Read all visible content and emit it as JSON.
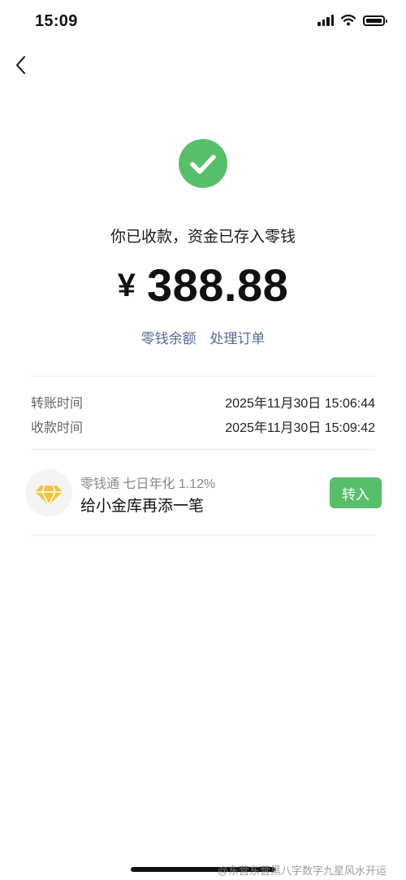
{
  "status_bar": {
    "time": "15:09"
  },
  "result": {
    "message": "你已收款，资金已存入零钱",
    "currency_symbol": "¥",
    "amount": "388.88"
  },
  "links": {
    "balance": "零钱余额",
    "process_order": "处理订单"
  },
  "details": {
    "transfer_time_label": "转账时间",
    "transfer_time_value": "2025年11月30日 15:06:44",
    "receive_time_label": "收款时间",
    "receive_time_value": "2025年11月30日 15:09:42"
  },
  "promo": {
    "subtitle": "零钱通 七日年化 1.12%",
    "title": "给小金库再添一笔",
    "button_label": "转入",
    "icon": "diamond-icon"
  },
  "watermark": "@东营东营黑八字数字九星风水开运",
  "colors": {
    "accent_green": "#57be6a",
    "link_blue": "#576b95",
    "diamond_yellow": "#f5c242"
  }
}
